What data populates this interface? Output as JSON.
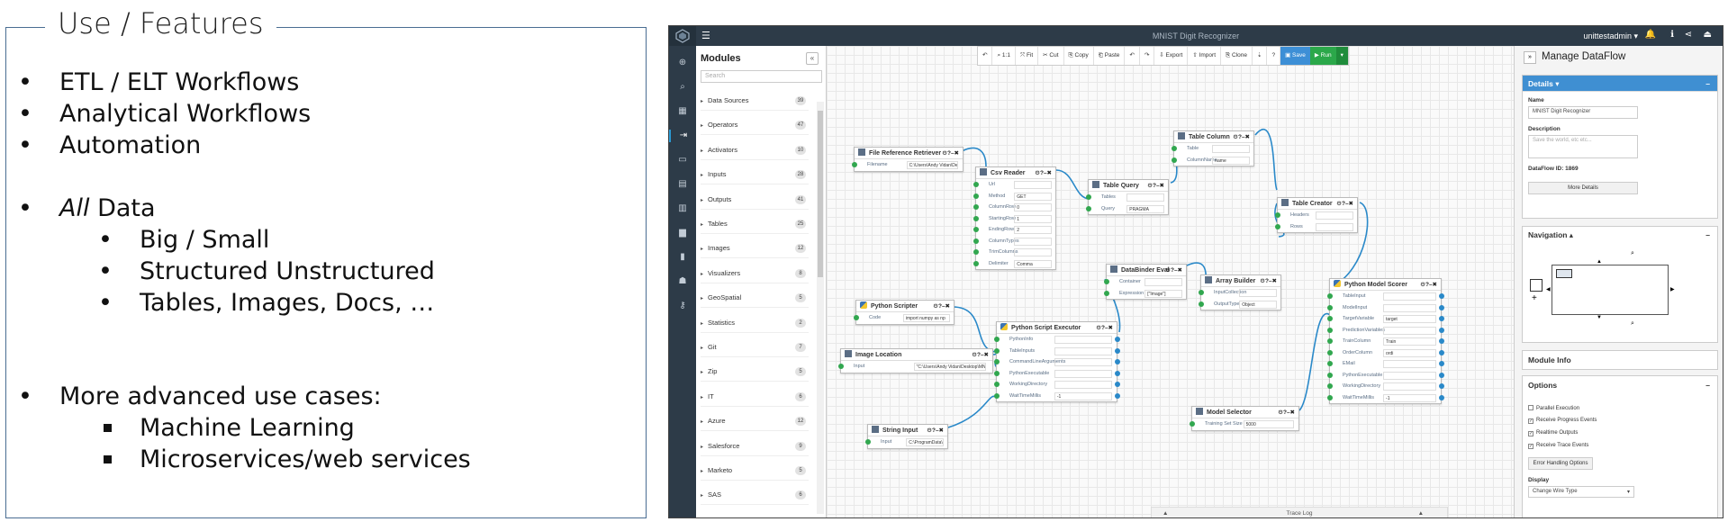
{
  "features": {
    "title": "Use / Features",
    "items": [
      {
        "bullet": "•",
        "text": "ETL / ELT Workflows"
      },
      {
        "bullet": "•",
        "text": "Analytical Workflows"
      },
      {
        "bullet": "•",
        "text": "Automation"
      },
      {
        "bullet": "•",
        "em": "All",
        "text": " Data"
      },
      {
        "bullet": "•",
        "text": "Big / Small"
      },
      {
        "bullet": "•",
        "text": "Structured Unstructured"
      },
      {
        "bullet": "•",
        "text": "Tables, Images, Docs, …"
      },
      {
        "bullet": "•",
        "text": "More advanced use cases:"
      },
      {
        "bullet": "square",
        "text": "Machine Learning"
      },
      {
        "bullet": "square",
        "text": "Microservices/web services"
      }
    ]
  },
  "app": {
    "title": "MNIST Digit Recognizer",
    "user": "unittestadmin ▾",
    "topbar_icons": [
      "bell-icon",
      "info-icon",
      "share-icon",
      "logout-icon"
    ],
    "topbar_glyphs": [
      "🔔",
      "ℹ",
      "⋖",
      "⏏"
    ],
    "rail_icons": [
      "⊕",
      "⌕",
      "▦",
      "⇥",
      "▭",
      "▤",
      "▥",
      "▆",
      "▮",
      "☗",
      "⚷"
    ],
    "modules": {
      "header": "Modules",
      "close": "«",
      "search_placeholder": "Search",
      "categories": [
        {
          "label": "Data Sources",
          "count": "39"
        },
        {
          "label": "Operators",
          "count": "47"
        },
        {
          "label": "Activators",
          "count": "10"
        },
        {
          "label": "Inputs",
          "count": "28"
        },
        {
          "label": "Outputs",
          "count": "41"
        },
        {
          "label": "Tables",
          "count": "25"
        },
        {
          "label": "Images",
          "count": "12"
        },
        {
          "label": "Visualizers",
          "count": "8"
        },
        {
          "label": "GeoSpatial",
          "count": "5"
        },
        {
          "label": "Statistics",
          "count": "2"
        },
        {
          "label": "Git",
          "count": "7"
        },
        {
          "label": "Zip",
          "count": "5"
        },
        {
          "label": "IT",
          "count": "6"
        },
        {
          "label": "Azure",
          "count": "12"
        },
        {
          "label": "Salesforce",
          "count": "9"
        },
        {
          "label": "Marketo",
          "count": "5"
        },
        {
          "label": "SAS",
          "count": "6"
        }
      ]
    },
    "toolbar": {
      "undo": "↶",
      "zoom": "⌕ 1:1",
      "fit": "⤧ Fit",
      "cut": "✂ Cut",
      "copy": "⎘ Copy",
      "paste": "⎗ Paste",
      "undo2": "↶",
      "redo": "↷",
      "export": "⇩ Export",
      "import": "⇧ Import",
      "clone": "⎘ Clone",
      "download": "⇣",
      "help": "?",
      "save": "▣ Save",
      "run": "▶ Run",
      "drop": "▾"
    },
    "nodes": {
      "file_ref": {
        "title": "File Reference Retriever",
        "controls": "⚙?–✖",
        "props": [
          {
            "label": "Filename",
            "value": "C:\\Users\\Andy Vidan\\Desktop\\MNI"
          }
        ]
      },
      "csv_reader": {
        "title": "Csv Reader",
        "controls": "⚙?–✖",
        "props": [
          {
            "label": "Url",
            "value": ""
          },
          {
            "label": "Method",
            "value": "GET"
          },
          {
            "label": "ColumnRow",
            "value": "0"
          },
          {
            "label": "StartingRow",
            "value": "1"
          },
          {
            "label": "EndingRow",
            "value": "2"
          },
          {
            "label": "ColumnTypes",
            "value": ""
          },
          {
            "label": "TrimColumns",
            "value": ""
          },
          {
            "label": "Delimiter",
            "value": "Comma"
          }
        ]
      },
      "table_query": {
        "title": "Table Query",
        "controls": "⚙?–✖",
        "props": [
          {
            "label": "Tables",
            "value": ""
          },
          {
            "label": "Query",
            "value": "PRAGMA"
          }
        ]
      },
      "table_column": {
        "title": "Table Column",
        "controls": "⚙?–✖",
        "props": [
          {
            "label": "Table",
            "value": ""
          },
          {
            "label": "ColumnName",
            "value": "name"
          }
        ]
      },
      "table_creator": {
        "title": "Table Creator",
        "controls": "⚙?–✖",
        "props": [
          {
            "label": "Headers",
            "value": ""
          },
          {
            "label": "Rows",
            "value": ""
          }
        ]
      },
      "databinder": {
        "title": "DataBinder Eval",
        "controls": "⚙?–✖",
        "props": [
          {
            "label": "Container",
            "value": ""
          },
          {
            "label": "Expression",
            "value": "[\"Image\"]"
          }
        ]
      },
      "array_builder": {
        "title": "Array Builder",
        "controls": "⚙?–✖",
        "props": [
          {
            "label": "InputCollection",
            "value": ""
          },
          {
            "label": "OutputType",
            "value": "Object"
          }
        ]
      },
      "py_scripter": {
        "title": "Python Scripter",
        "controls": "⚙?–✖",
        "props": [
          {
            "label": "Code",
            "value": "import numpy as np"
          }
        ]
      },
      "image_loc": {
        "title": "Image Location",
        "controls": "⚙?–✖",
        "props": [
          {
            "label": "Input",
            "value": "\"C:\\Users\\Andy Vidan\\Desktop\\MNIST\\sevenX.png\""
          }
        ]
      },
      "py_executor": {
        "title": "Python Script Executor",
        "controls": "⚙?–✖",
        "props": [
          {
            "label": "PythonInfo",
            "value": ""
          },
          {
            "label": "TableInputs",
            "value": ""
          },
          {
            "label": "CommandLineArguments",
            "value": ""
          },
          {
            "label": "PythonExecutable",
            "value": ""
          },
          {
            "label": "WorkingDirectory",
            "value": ""
          },
          {
            "label": "WaitTimeMillis",
            "value": "-1"
          }
        ]
      },
      "string_input": {
        "title": "String Input",
        "controls": "⚙?–✖",
        "props": [
          {
            "label": "Input",
            "value": "C:\\ProgramData\\Anaco"
          }
        ]
      },
      "model_selector": {
        "title": "Model Selector",
        "controls": "⚙?–✖",
        "props": [
          {
            "label": "Training Set Size",
            "value": "5000"
          }
        ]
      },
      "py_scorer": {
        "title": "Python Model Scorer",
        "controls": "⚙?–✖",
        "props": [
          {
            "label": "TableInput",
            "value": ""
          },
          {
            "label": "ModelInput",
            "value": ""
          },
          {
            "label": "TargetVariable",
            "value": "target"
          },
          {
            "label": "PredictionVariables",
            "value": ""
          },
          {
            "label": "TrainColumn",
            "value": "Train"
          },
          {
            "label": "OrderColumn",
            "value": "ordi"
          },
          {
            "label": "EMail",
            "value": ""
          },
          {
            "label": "PythonExecutable",
            "value": ""
          },
          {
            "label": "WorkingDirectory",
            "value": ""
          },
          {
            "label": "WaitTimeMillis",
            "value": "-1"
          }
        ]
      }
    },
    "trace_log": "Trace Log",
    "trace_arrows": "▲",
    "right": {
      "toggle": "»",
      "title": "Manage DataFlow",
      "details_title": "Details ▾",
      "collapse": "–",
      "name_label": "Name",
      "name_value": "MNIST Digit Recognizer",
      "desc_label": "Description",
      "desc_placeholder": "Save the world, etc etc...",
      "id_label": "DataFlow ID: 1869",
      "more_details": "More Details",
      "navigation_title": "Navigation ▴",
      "zoom_in": "⌕",
      "zoom_out": "⌕",
      "nav_up": "▲",
      "nav_down": "▼",
      "nav_left": "◀",
      "nav_right": "▶",
      "nav_plus": "+",
      "module_info_title": "Module Info",
      "options_title": "Options",
      "options": [
        {
          "label": "Parallel Execution",
          "checked": ""
        },
        {
          "label": "Receive Progress Events",
          "checked": "✓"
        },
        {
          "label": "Realtime Outputs",
          "checked": "✓"
        },
        {
          "label": "Receive Trace Events",
          "checked": "✓"
        }
      ],
      "error_btn": "Error Handling Options",
      "display_label": "Display",
      "display_value": "Change Wire Type",
      "display_caret": "▾"
    }
  }
}
